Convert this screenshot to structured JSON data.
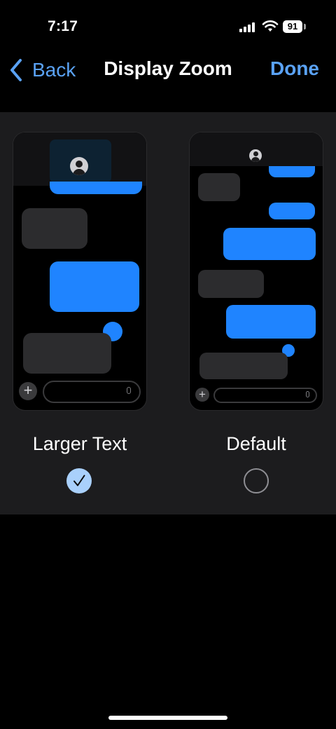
{
  "status": {
    "time": "7:17",
    "battery": "91"
  },
  "nav": {
    "back_label": "Back",
    "title": "Display Zoom",
    "done_label": "Done"
  },
  "options": [
    {
      "label": "Larger Text",
      "selected": true
    },
    {
      "label": "Default",
      "selected": false
    }
  ],
  "colors": {
    "accent": "#5aa2f5",
    "bubble_blue": "#1f84ff",
    "bubble_gray": "#2c2c2e",
    "panel": "#1c1c1e"
  },
  "icons": [
    "chevron-left-icon",
    "signal-icon",
    "wifi-icon",
    "battery-icon",
    "avatar-icon",
    "plus-icon",
    "mic-icon",
    "checkmark-icon"
  ]
}
